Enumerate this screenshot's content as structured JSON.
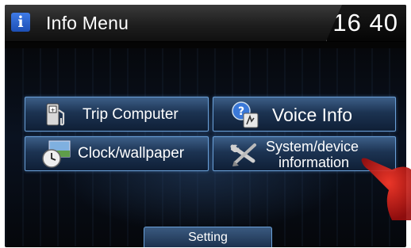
{
  "header": {
    "title": "Info Menu",
    "clock": "16 40",
    "info_glyph": "i"
  },
  "menu": {
    "trip_label": "Trip Computer",
    "voice_label": "Voice Info",
    "clock_label": "Clock/wallpaper",
    "system_label_line1": "System/device",
    "system_label_line2": "information"
  },
  "footer": {
    "setting_label": "Setting"
  },
  "icons": [
    "info-icon",
    "fuel-pump-icon",
    "voice-help-icon",
    "clock-icon",
    "wrench-screwdriver-icon"
  ],
  "colors": {
    "accent_border": "#6aa0d8",
    "button_top": "#3d5f88",
    "button_bottom": "#0f1f36",
    "info_icon": "#2a62cf"
  }
}
